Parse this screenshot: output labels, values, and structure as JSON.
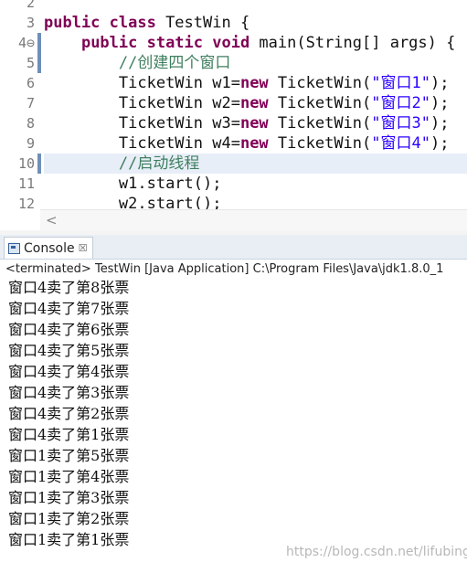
{
  "editor": {
    "line_numbers": [
      "2",
      "3",
      "4⊖",
      "5",
      "6",
      "7",
      "8",
      "9",
      "10",
      "11",
      "12"
    ],
    "lines": [
      {
        "text": ""
      },
      {
        "kw1": "public class",
        "rest": " TestWin {"
      },
      {
        "indent": "    ",
        "kw1": "public static void",
        "rest": " main(String[] args) {"
      },
      {
        "indent": "        ",
        "comment": "//创建四个窗口"
      },
      {
        "indent": "        ",
        "pre": "TicketWin w1=",
        "kw": "new",
        "post": " TicketWin(",
        "str": "\"窗口1\"",
        "tail": ");"
      },
      {
        "indent": "        ",
        "pre": "TicketWin w2=",
        "kw": "new",
        "post": " TicketWin(",
        "str": "\"窗口2\"",
        "tail": ");"
      },
      {
        "indent": "        ",
        "pre": "TicketWin w3=",
        "kw": "new",
        "post": " TicketWin(",
        "str": "\"窗口3\"",
        "tail": ");"
      },
      {
        "indent": "        ",
        "pre": "TicketWin w4=",
        "kw": "new",
        "post": " TicketWin(",
        "str": "\"窗口4\"",
        "tail": ");"
      },
      {
        "indent": "        ",
        "comment": "//启动线程"
      },
      {
        "indent": "        ",
        "pre": "w1.start();"
      },
      {
        "indent": "        ",
        "pre": "w2.start();"
      }
    ],
    "scroll_left_arrow": "<"
  },
  "console": {
    "tab_label": "Console",
    "tab_close": "☒",
    "status": "<terminated> TestWin [Java Application] C:\\Program Files\\Java\\jdk1.8.0_1",
    "output": [
      "窗口4卖了第8张票",
      "窗口4卖了第7张票",
      "窗口4卖了第6张票",
      "窗口4卖了第5张票",
      "窗口4卖了第4张票",
      "窗口4卖了第3张票",
      "窗口4卖了第2张票",
      "窗口4卖了第1张票",
      "窗口1卖了第5张票",
      "窗口1卖了第4张票",
      "窗口1卖了第3张票",
      "窗口1卖了第2张票",
      "窗口1卖了第1张票"
    ]
  },
  "watermark": "https://blog.csdn.net/lifubing"
}
